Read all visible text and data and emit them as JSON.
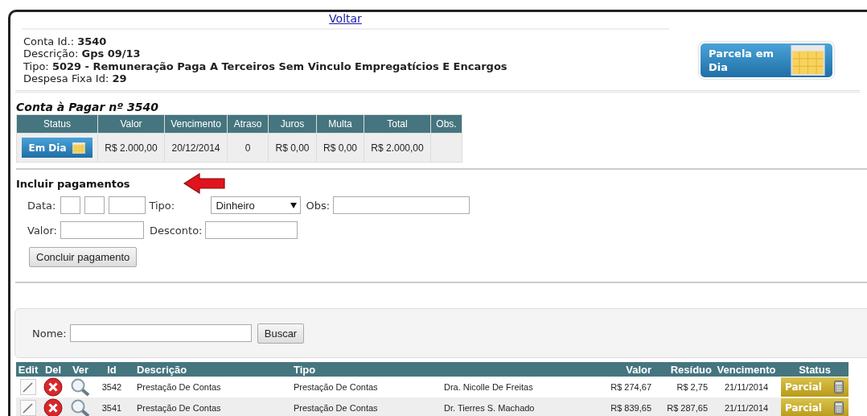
{
  "back_link": "Voltar",
  "account": {
    "fields": [
      {
        "label": "Conta Id.:",
        "value": "3540"
      },
      {
        "label": "Descrição:",
        "value": "Gps 09/13"
      },
      {
        "label": "Tipo:",
        "value": "5029 - Remuneração Paga A Terceiros Sem Vinculo Empregatícios E Encargos"
      },
      {
        "label": "Despesa Fixa Id:",
        "value": "29"
      }
    ],
    "status_button": {
      "label": "Parcela em Dia",
      "kind": "em-dia"
    }
  },
  "payable": {
    "title": "Conta à Pagar nº 3540",
    "columns": [
      "Status",
      "Valor",
      "Vencimento",
      "Atraso",
      "Juros",
      "Multa",
      "Total",
      "Obs."
    ],
    "row": {
      "status": {
        "label": "Em Dia",
        "kind": "em-dia"
      },
      "valor": "R$ 2.000,00",
      "vencimento": "20/12/2014",
      "atraso": "0",
      "juros": "R$ 0,00",
      "multa": "R$ 0,00",
      "total": "R$ 2.000,00"
    }
  },
  "payment_form": {
    "title": "Incluir pagamentos",
    "data_label": "Data:",
    "tipo_label": "Tipo:",
    "tipo_value": "Dinheiro",
    "obs_label": "Obs:",
    "valor_label": "Valor:",
    "desconto_label": "Desconto:",
    "submit": "Concluir pagamento"
  },
  "search": {
    "label": "Nome:",
    "button": "Buscar"
  },
  "results": {
    "columns": [
      "Edit",
      "Del",
      "Ver",
      "Id",
      "Descrição",
      "Tipo",
      "",
      "Valor",
      "Resíduo",
      "Vencimento",
      "Status"
    ],
    "rows": [
      {
        "id": "3542",
        "descricao": "Prestação De Contas",
        "tipo": "Prestação De Contas",
        "column_7": "Dra. Nicolle De Freitas",
        "valor": "R$ 274,67",
        "residuo": "R$ 2,75",
        "vencimento": "21/11/2014",
        "status": {
          "label": "Parcial",
          "kind": "parcial"
        }
      },
      {
        "id": "3541",
        "descricao": "Prestação De Contas",
        "tipo": "Prestação De Contas",
        "column_7": "Dr. Tierres S. Machado",
        "valor": "R$ 839,65",
        "residuo": "R$ 287,65",
        "vencimento": "21/11/2014",
        "status": {
          "label": "Parcial",
          "kind": "parcial"
        }
      }
    ]
  }
}
